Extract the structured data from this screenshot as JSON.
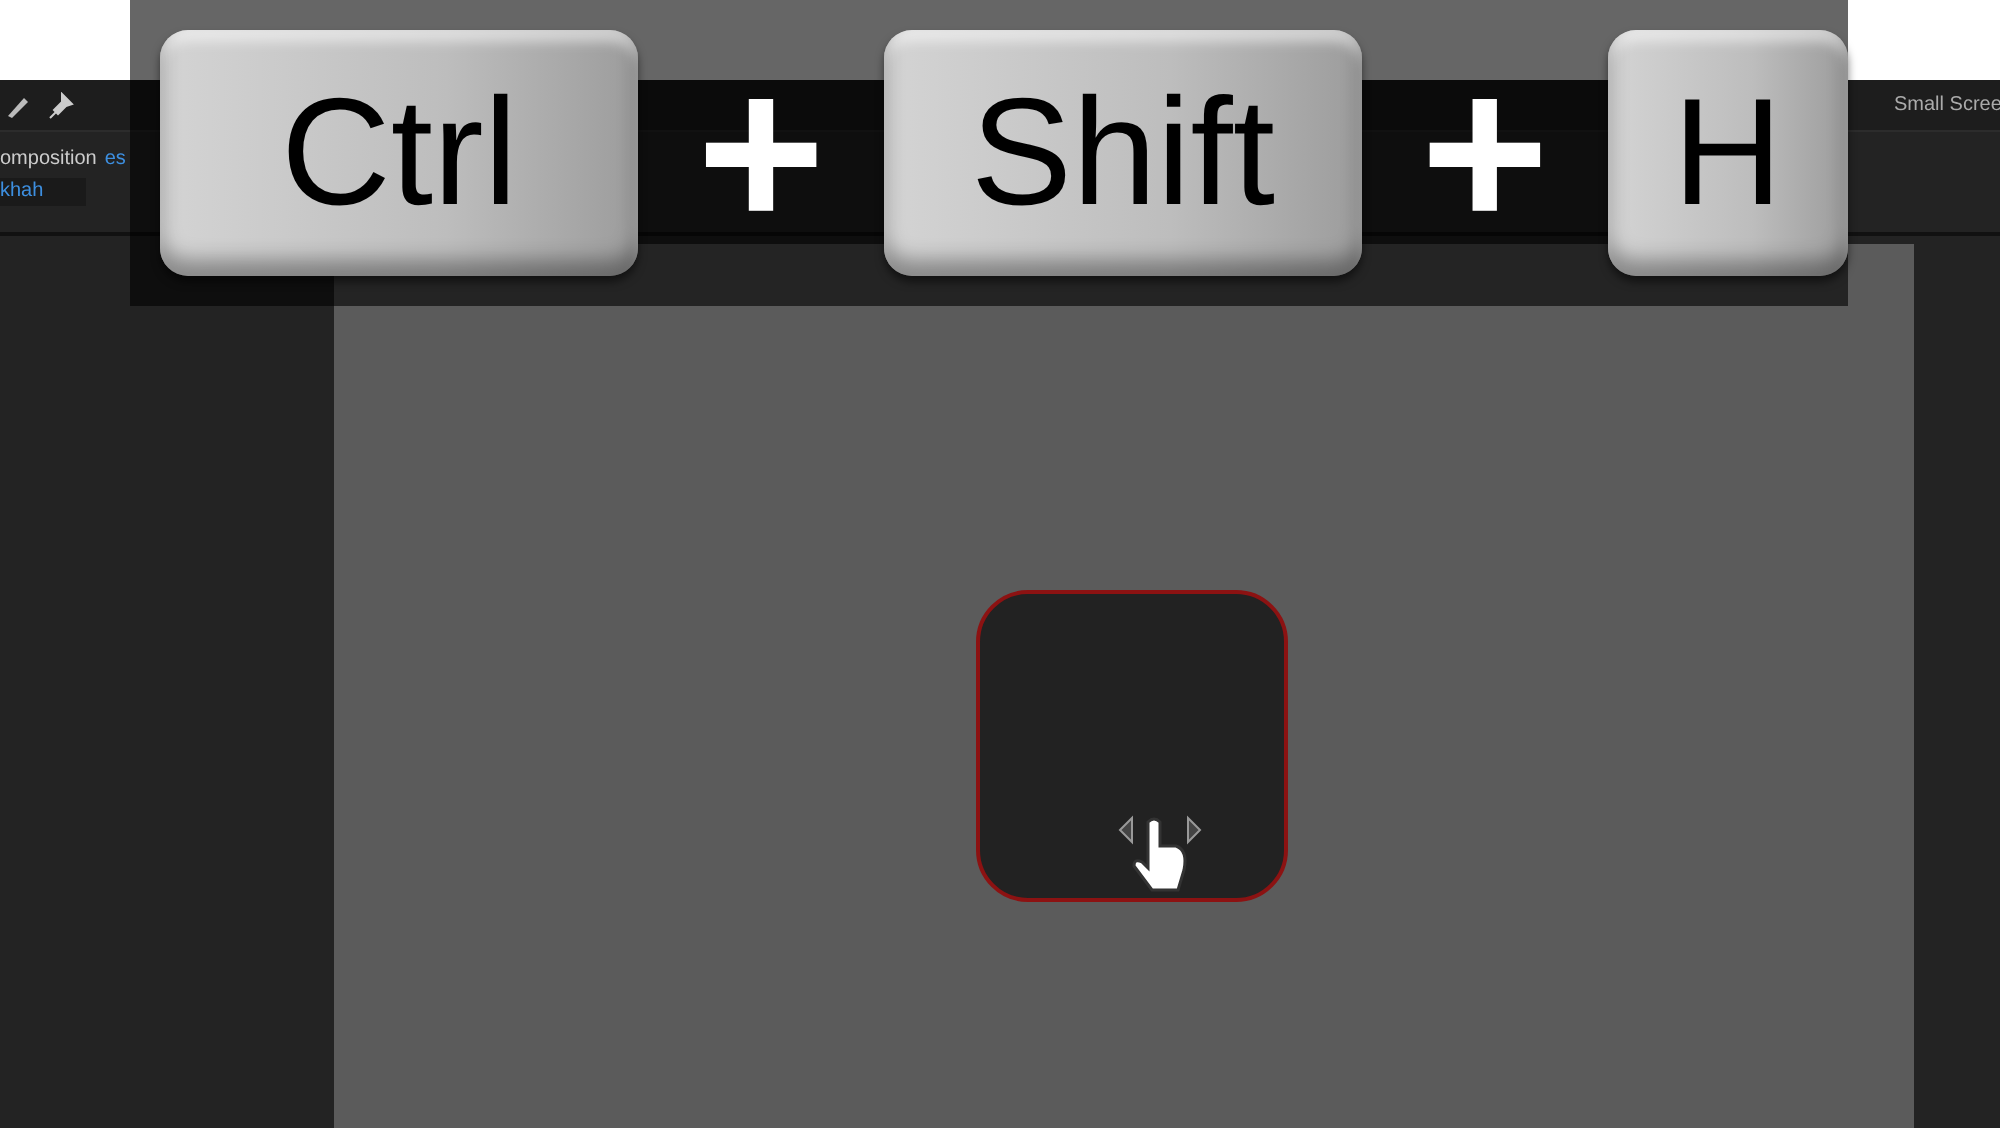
{
  "toolbar": {
    "items": [
      {
        "kind": "brush"
      },
      {
        "kind": "pin"
      }
    ],
    "workspace": "Small Scree"
  },
  "panel": {
    "label": "omposition",
    "link": "es",
    "field_value": "khah"
  },
  "shortcut": {
    "keys": [
      {
        "kind": "key",
        "label": "Ctrl"
      },
      {
        "kind": "plus",
        "label": "+"
      },
      {
        "kind": "key",
        "label": "Shift"
      },
      {
        "kind": "plus",
        "label": "+"
      },
      {
        "kind": "key",
        "label": "H"
      }
    ]
  },
  "canvas": {
    "shape": {
      "selected": true
    }
  }
}
